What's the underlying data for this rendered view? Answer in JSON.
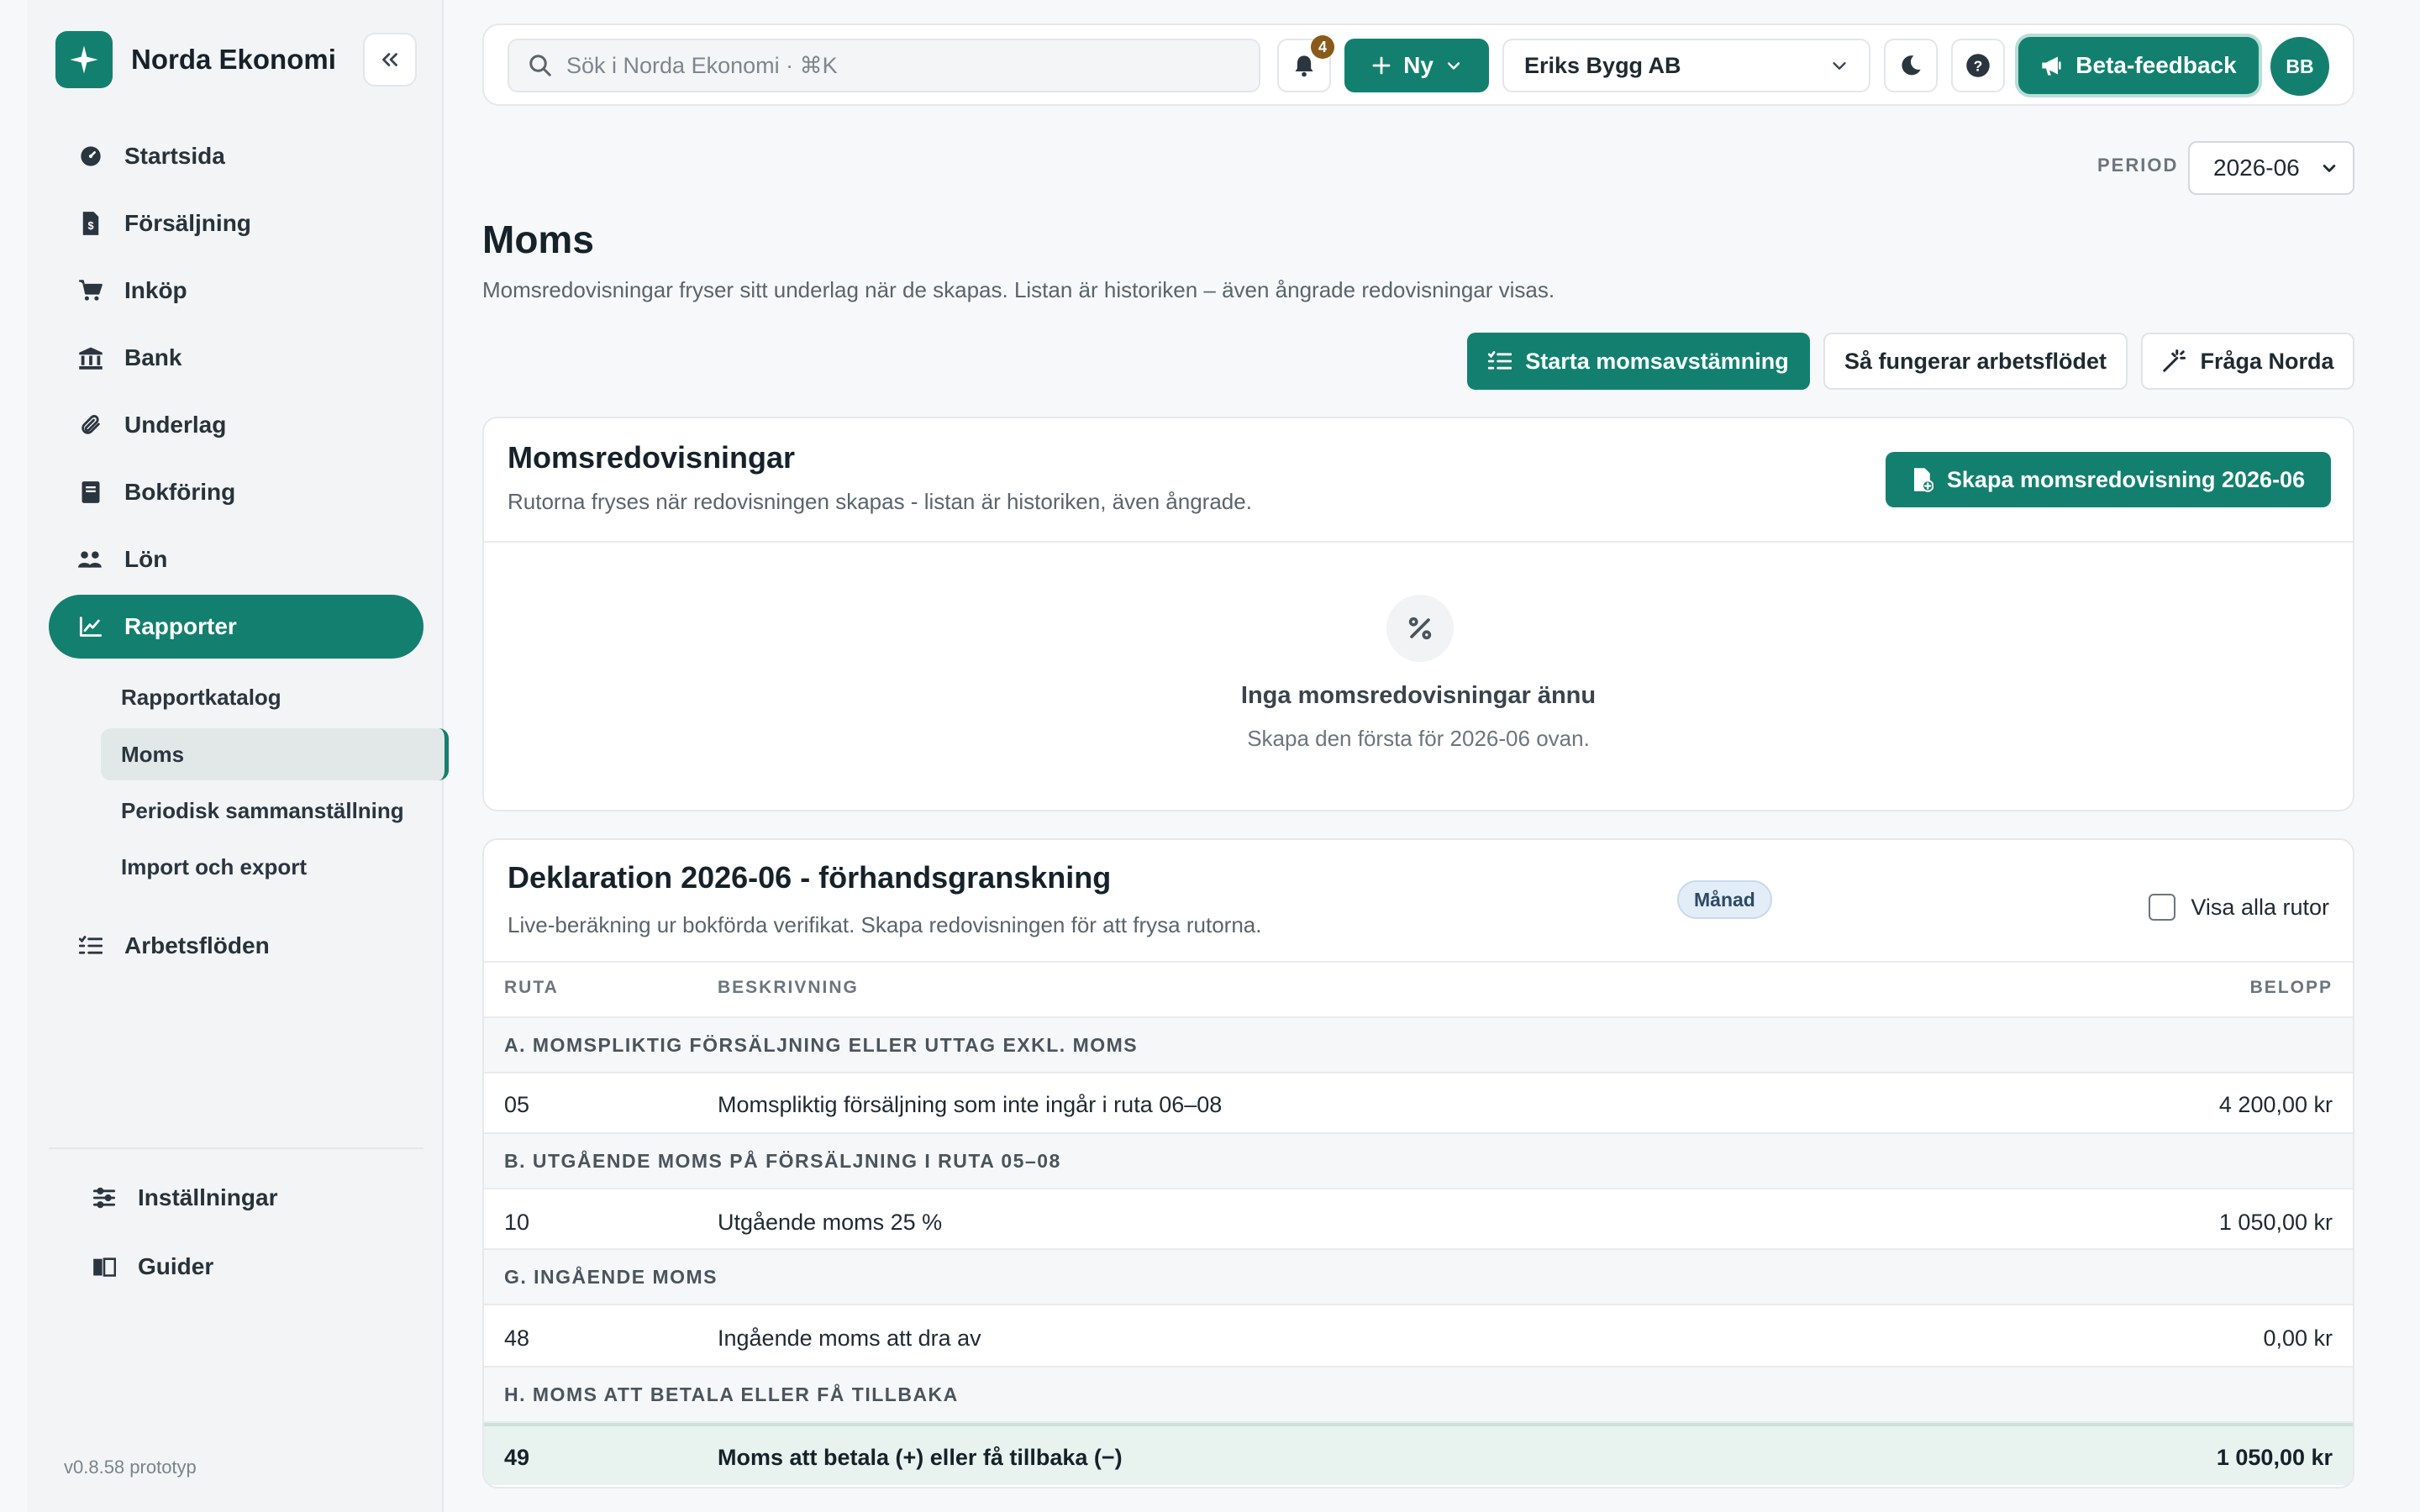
{
  "app": {
    "name": "Norda Ekonomi",
    "version": "v0.8.58 prototyp"
  },
  "colors": {
    "accent": "#13806f",
    "badge_bg": "#e3edf7",
    "notif": "#8a5a1a"
  },
  "sidebar": {
    "items": [
      {
        "label": "Startsida",
        "icon": "dashboard-icon"
      },
      {
        "label": "Försäljning",
        "icon": "invoice-icon"
      },
      {
        "label": "Inköp",
        "icon": "cart-icon"
      },
      {
        "label": "Bank",
        "icon": "bank-icon"
      },
      {
        "label": "Underlag",
        "icon": "paperclip-icon"
      },
      {
        "label": "Bokföring",
        "icon": "book-icon"
      },
      {
        "label": "Lön",
        "icon": "people-icon"
      },
      {
        "label": "Rapporter",
        "icon": "chart-line-icon",
        "active": true
      }
    ],
    "sub_items": [
      {
        "label": "Rapportkatalog"
      },
      {
        "label": "Moms",
        "active": true
      },
      {
        "label": "Periodisk sammanställning"
      },
      {
        "label": "Import och export"
      }
    ],
    "workflows": {
      "label": "Arbetsflöden",
      "icon": "checklist-icon"
    },
    "settings": {
      "label": "Inställningar",
      "icon": "sliders-icon"
    },
    "guides": {
      "label": "Guider",
      "icon": "book-open-icon"
    }
  },
  "topbar": {
    "search_placeholder": "Sök i Norda Ekonomi · ⌘K",
    "notifications_count": "4",
    "new_label": "Ny",
    "company": "Eriks Bygg AB",
    "beta_label": "Beta-feedback",
    "avatar_initials": "BB"
  },
  "period": {
    "label": "PERIOD",
    "value": "2026-06"
  },
  "page": {
    "title": "Moms",
    "description": "Momsredovisningar fryser sitt underlag när de skapas. Listan är historiken – även ångrade redovisningar visas.",
    "actions": {
      "start": "Starta momsavstämning",
      "how": "Så fungerar arbetsflödet",
      "ask": "Fråga Norda"
    }
  },
  "returns_card": {
    "title": "Momsredovisningar",
    "subtitle": "Rutorna fryses när redovisningen skapas - listan är historiken, även ångrade.",
    "create_label": "Skapa momsredovisning 2026-06",
    "empty_title": "Inga momsredovisningar ännu",
    "empty_sub": "Skapa den första för 2026-06 ovan."
  },
  "declaration": {
    "title": "Deklaration 2026-06 - förhandsgranskning",
    "subtitle": "Live-beräkning ur bokförda verifikat. Skapa redovisningen för att frysa rutorna.",
    "badge": "Månad",
    "show_all": "Visa alla rutor",
    "columns": {
      "ruta": "RUTA",
      "beskrivning": "BESKRIVNING",
      "belopp": "BELOPP"
    },
    "sections": [
      {
        "heading": "A. MOMSPLIKTIG FÖRSÄLJNING ELLER UTTAG EXKL. MOMS",
        "ruta": "05",
        "desc": "Momspliktig försäljning som inte ingår i ruta 06–08",
        "amount": "4 200,00 kr"
      },
      {
        "heading": "B. UTGÅENDE MOMS PÅ FÖRSÄLJNING I RUTA 05–08",
        "ruta": "10",
        "desc": "Utgående moms 25 %",
        "amount": "1 050,00 kr"
      },
      {
        "heading": "G. INGÅENDE MOMS",
        "ruta": "48",
        "desc": "Ingående moms att dra av",
        "amount": "0,00 kr"
      }
    ],
    "total": {
      "heading": "H. MOMS ATT BETALA ELLER FÅ TILLBAKA",
      "ruta": "49",
      "desc": "Moms att betala (+) eller få tillbaka (−)",
      "amount": "1 050,00 kr"
    }
  }
}
